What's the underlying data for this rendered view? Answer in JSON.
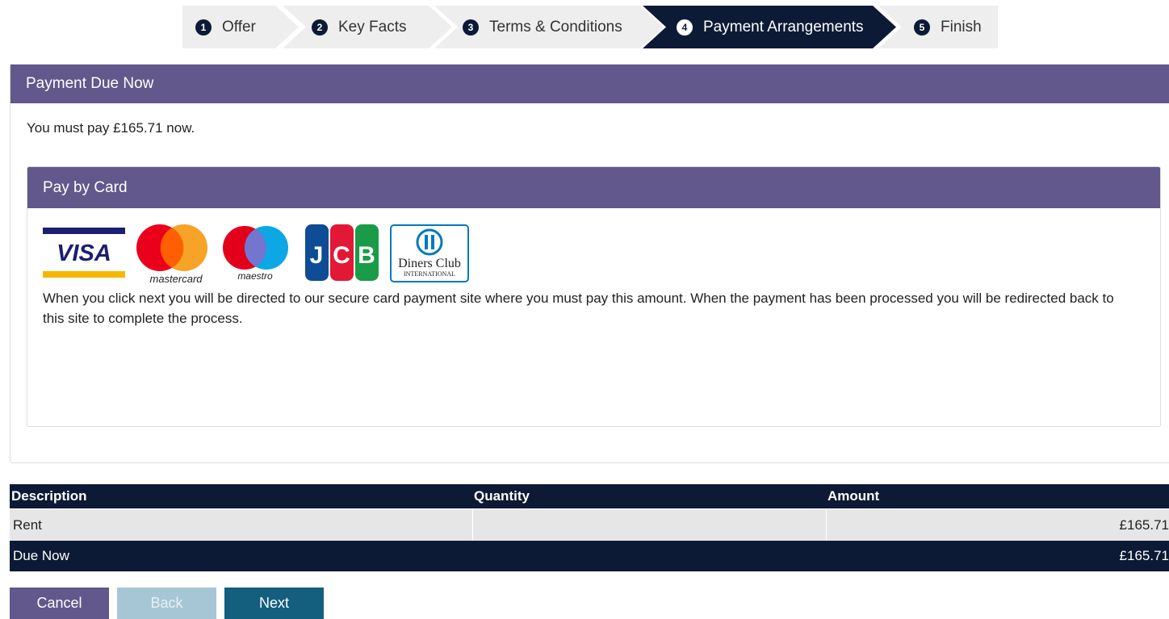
{
  "steps": [
    {
      "number": "1",
      "label": "Offer"
    },
    {
      "number": "2",
      "label": "Key Facts"
    },
    {
      "number": "3",
      "label": "Terms & Conditions"
    },
    {
      "number": "4",
      "label": "Payment Arrangements",
      "active": true
    },
    {
      "number": "5",
      "label": "Finish"
    }
  ],
  "payment_panel": {
    "title": "Payment Due Now",
    "message": "You must pay £165.71 now."
  },
  "card_panel": {
    "title": "Pay by Card",
    "logos": {
      "visa": "VISA",
      "mastercard": "mastercard",
      "maestro": "maestro",
      "jcb": "JCB",
      "diners": "Diners Club",
      "diners_sub": "INTERNATIONAL"
    },
    "description": "When you click next you will be directed to our secure card payment site where you must pay this amount. When the payment has been processed you will be redirected back to this site to complete the process."
  },
  "table": {
    "headers": [
      "Description",
      "Quantity",
      "Amount"
    ],
    "rows": [
      {
        "description": "Rent",
        "quantity": "",
        "amount": "£165.71"
      }
    ],
    "total": {
      "label": "Due Now",
      "amount": "£165.71"
    }
  },
  "buttons": {
    "cancel": "Cancel",
    "back": "Back",
    "next": "Next"
  },
  "colors": {
    "panel_header": "#62588b",
    "navy": "#0c1a36",
    "step_bg": "#eeeeee",
    "next_button": "#145e7e",
    "back_button_disabled": "#a6c6d6"
  }
}
